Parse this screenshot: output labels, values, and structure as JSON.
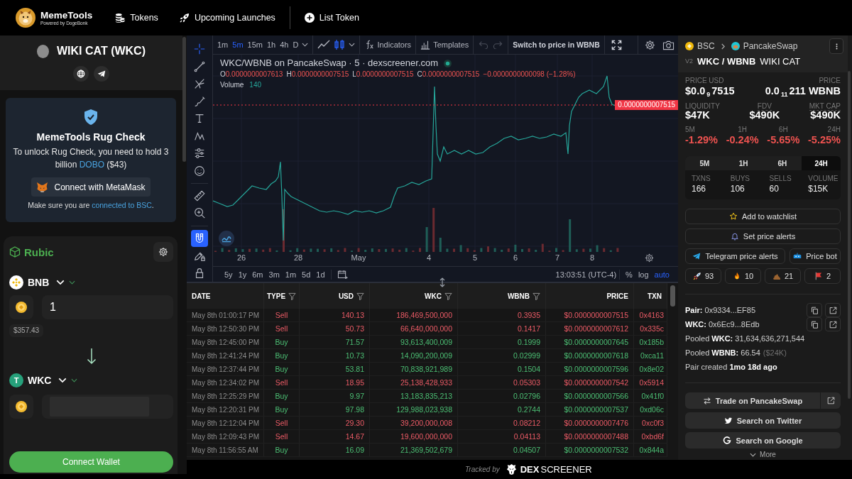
{
  "nav": {
    "brand": "MemeTools",
    "tagline": "Powered by DogeBonk",
    "links": [
      {
        "kind": "coins",
        "label": "Tokens"
      },
      {
        "kind": "rocket",
        "label": "Upcoming Launches"
      },
      {
        "kind": "plus",
        "label": "List Token"
      }
    ]
  },
  "token": {
    "name": "WIKI CAT (WKC)"
  },
  "rug_check": {
    "title": "MemeTools Rug Check",
    "message_start": "To unlock Rug Check, you need to hold 3 billion",
    "message_link": "DOBO",
    "message_end": "($43)",
    "button": "Connect with MetaMask",
    "note_start": "Make sure you are",
    "note_link": "connected to BSC",
    "note_end": "."
  },
  "swap": {
    "brand": "Rubic",
    "from": {
      "token": "BNB",
      "amount": "1",
      "usd": "$357.43"
    },
    "to": {
      "token": "WKC",
      "initial": "T",
      "loading": true
    },
    "button": "Connect Wallet"
  },
  "chart": {
    "drawing_tools": [
      {
        "kind": "crosshair",
        "selected": true
      },
      {
        "kind": "trend-line",
        "selected": false
      },
      {
        "kind": "pitchfork",
        "selected": false
      },
      {
        "kind": "brush",
        "selected": false
      },
      {
        "kind": "text",
        "selected": false
      },
      {
        "kind": "pattern",
        "selected": false
      },
      {
        "kind": "forecast",
        "selected": false
      },
      {
        "kind": "emoji",
        "selected": false
      }
    ],
    "utility_tools": [
      {
        "kind": "ruler",
        "on": false
      },
      {
        "kind": "zoom",
        "on": false
      },
      {
        "kind": "magnet",
        "on": true
      },
      {
        "kind": "lock-drawing",
        "on": false
      },
      {
        "kind": "lock",
        "on": false
      }
    ],
    "intervals": [
      {
        "label": "1m",
        "selected": false
      },
      {
        "label": "5m",
        "selected": true
      },
      {
        "label": "15m",
        "selected": false
      },
      {
        "label": "1h",
        "selected": false
      },
      {
        "label": "4h",
        "selected": false
      },
      {
        "label": "D",
        "selected": false
      }
    ],
    "chart_types": [
      {
        "kind": "line",
        "selected": false
      },
      {
        "kind": "candles",
        "selected": true
      }
    ],
    "indicators": "Indicators",
    "templates": "Templates",
    "history": [
      {
        "kind": "undo",
        "disabled": true
      },
      {
        "kind": "redo",
        "disabled": true
      }
    ],
    "switch_label": "Switch to price in WBNB",
    "title": "WKC/WBNB on PancakeSwap · 5 · dexscreener.com",
    "ohlc": [
      {
        "label": "O",
        "value": "0.0000000007613"
      },
      {
        "label": "H",
        "value": "0.0000000007515"
      },
      {
        "label": "L",
        "value": "0.0000000007515"
      },
      {
        "label": "C",
        "value": "0.0000000007515"
      }
    ],
    "change": "−0.0000000000098 (−1.28%)",
    "volume_label": "Volume",
    "volume_value": "140",
    "price_tag": "0.0000000007515",
    "x_labels": [
      "26",
      "28",
      "May",
      "4",
      "5",
      "6",
      "7",
      "8"
    ],
    "ranges": [
      "5y",
      "1y",
      "6m",
      "3m",
      "1m",
      "5d",
      "1d"
    ],
    "clock": "13:03:51 (UTC-4)",
    "scales": [
      {
        "label": "%",
        "selected": false
      },
      {
        "label": "log",
        "selected": false
      },
      {
        "label": "auto",
        "selected": true
      }
    ]
  },
  "table": {
    "columns": [
      {
        "label": "DATE",
        "filter": false
      },
      {
        "label": "TYPE",
        "filter": true
      },
      {
        "label": "USD",
        "filter": true
      },
      {
        "label": "WKC",
        "filter": true
      },
      {
        "label": "WBNB",
        "filter": true
      },
      {
        "label": "PRICE",
        "filter": false
      },
      {
        "label": "TXN",
        "filter": false
      }
    ],
    "rows": [
      {
        "date": "May 8th 01:00:17 PM",
        "type": "Sell",
        "kind": "sell",
        "usd": "140.13",
        "wkc": "186,469,500,000",
        "wbnb": "0.3935",
        "price": "$0.0000000007515",
        "txn": "0x4163"
      },
      {
        "date": "May 8th 12:50:30 PM",
        "type": "Sell",
        "kind": "sell",
        "usd": "50.73",
        "wkc": "66,640,000,000",
        "wbnb": "0.1417",
        "price": "$0.0000000007612",
        "txn": "0x335c"
      },
      {
        "date": "May 8th 12:45:00 PM",
        "type": "Buy",
        "kind": "buy",
        "usd": "71.57",
        "wkc": "93,613,400,009",
        "wbnb": "0.1999",
        "price": "$0.0000000007645",
        "txn": "0x185b"
      },
      {
        "date": "May 8th 12:41:24 PM",
        "type": "Buy",
        "kind": "buy",
        "usd": "10.73",
        "wkc": "14,090,200,009",
        "wbnb": "0.02999",
        "price": "$0.0000000007618",
        "txn": "0xca11"
      },
      {
        "date": "May 8th 12:37:44 PM",
        "type": "Buy",
        "kind": "buy",
        "usd": "53.81",
        "wkc": "70,838,921,989",
        "wbnb": "0.1504",
        "price": "$0.0000000007596",
        "txn": "0x8e02"
      },
      {
        "date": "May 8th 12:34:02 PM",
        "type": "Sell",
        "kind": "sell",
        "usd": "18.95",
        "wkc": "25,138,428,933",
        "wbnb": "0.05303",
        "price": "$0.0000000007542",
        "txn": "0x5914"
      },
      {
        "date": "May 8th 12:25:29 PM",
        "type": "Buy",
        "kind": "buy",
        "usd": "9.97",
        "wkc": "13,183,835,213",
        "wbnb": "0.02796",
        "price": "$0.0000000007566",
        "txn": "0x41f0"
      },
      {
        "date": "May 8th 12:20:31 PM",
        "type": "Buy",
        "kind": "buy",
        "usd": "97.98",
        "wkc": "129,988,023,938",
        "wbnb": "0.2744",
        "price": "$0.0000000007537",
        "txn": "0xd06c"
      },
      {
        "date": "May 8th 12:12:04 PM",
        "type": "Sell",
        "kind": "sell",
        "usd": "29.30",
        "wkc": "39,200,000,008",
        "wbnb": "0.08212",
        "price": "$0.0000000007476",
        "txn": "0xc0f3"
      },
      {
        "date": "May 8th 12:09:43 PM",
        "type": "Sell",
        "kind": "sell",
        "usd": "14.67",
        "wkc": "19,600,000,000",
        "wbnb": "0.04113",
        "price": "$0.0000000007488",
        "txn": "0xbd6f"
      },
      {
        "date": "May 8th 11:56:55 AM",
        "type": "Buy",
        "kind": "buy",
        "usd": "16.09",
        "wkc": "21,369,502,679",
        "wbnb": "0.04507",
        "price": "$0.0000000007532",
        "txn": "0x844a"
      }
    ]
  },
  "footer": {
    "tracked_by": "Tracked by",
    "logo_bold": "DEX",
    "logo_light": "SCREENER"
  },
  "pair": {
    "chain": "BSC",
    "dex": "PancakeSwap",
    "version": "V2",
    "symbol": "WKC / WBNB",
    "name": "WIKI CAT"
  },
  "prices": [
    {
      "label": "PRICE USD",
      "value": "$0.0$_{9}$7515"
    },
    {
      "label": "PRICE",
      "value": "0.0$_{11}$211 WBNB"
    }
  ],
  "metrics": [
    {
      "label": "LIQUIDITY",
      "value": "$47K",
      "tooltip": false
    },
    {
      "label": "FDV",
      "value": "$490K",
      "tooltip": true
    },
    {
      "label": "MKT CAP",
      "value": "$490K",
      "tooltip": true
    }
  ],
  "changes": [
    {
      "label": "5M",
      "value": "-1.29%"
    },
    {
      "label": "1H",
      "value": "-0.24%"
    },
    {
      "label": "6H",
      "value": "-5.65%"
    },
    {
      "label": "24H",
      "value": "-5.25%"
    }
  ],
  "periods": [
    {
      "label": "5M",
      "selected": false
    },
    {
      "label": "1H",
      "selected": false
    },
    {
      "label": "6H",
      "selected": false
    },
    {
      "label": "24H",
      "selected": true
    }
  ],
  "txn_stats": [
    {
      "label": "TXNS",
      "value": "166"
    },
    {
      "label": "BUYS",
      "value": "106"
    },
    {
      "label": "SELLS",
      "value": "60"
    },
    {
      "label": "VOLUME",
      "value": "$15K"
    }
  ],
  "actions": [
    {
      "kind": "watchlist",
      "label": "Add to watchlist"
    },
    {
      "kind": "alerts",
      "label": "Set price alerts"
    },
    {
      "kind": "telegram",
      "label": "Telegram price alerts"
    },
    {
      "kind": "bot",
      "label": "Price bot"
    }
  ],
  "reactions": [
    {
      "kind": "rocket",
      "count": "93"
    },
    {
      "kind": "fire",
      "count": "10"
    },
    {
      "kind": "poop",
      "count": "21"
    },
    {
      "kind": "flag",
      "count": "2"
    }
  ],
  "addresses": [
    "**Pair:** 0x9334...EF85",
    "**WKC:** 0x6Ec9...8Edb"
  ],
  "pooled": [
    {
      "text": "Pooled **WKC:** 31,634,636,271,544"
    },
    {
      "text": "Pooled **WBNB:** 66.54",
      "note": "($24K)"
    }
  ],
  "created": "Pair created **1mo 18d ago**",
  "links": [
    {
      "kind": "trade",
      "label": "Trade on PancakeSwap"
    },
    {
      "kind": "twitter",
      "label": "Search on Twitter"
    },
    {
      "kind": "google",
      "label": "Search on Google"
    }
  ],
  "more": "More"
}
